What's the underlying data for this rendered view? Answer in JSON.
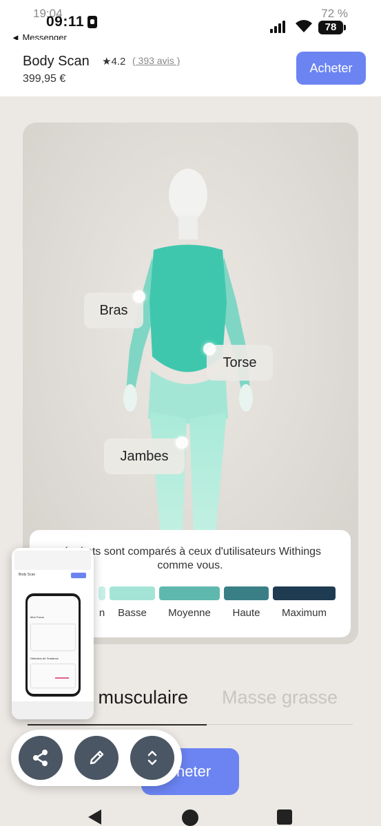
{
  "status_bar": {
    "ghost_time": "19:04",
    "time": "09:11",
    "ghost_battery": "72 %",
    "battery": "78",
    "back_app": "◄ Messenger"
  },
  "product": {
    "name": "Body Scan",
    "rating": "★4.2",
    "reviews": "( 393 avis )",
    "price": "399,95 €",
    "buy_label": "Acheter"
  },
  "body_scan": {
    "labels": {
      "arms": "Bras",
      "torso": "Torse",
      "legs": "Jambes"
    },
    "legend_text": "résultats sont comparés à ceux d'utilisateurs Withings comme vous.",
    "levels": [
      {
        "label": "n",
        "color": "#c7f0e6"
      },
      {
        "label": "Basse",
        "color": "#a3e4d6"
      },
      {
        "label": "Moyenne",
        "color": "#5fb8ad"
      },
      {
        "label": "Haute",
        "color": "#3b7f86"
      },
      {
        "label": "Maximum",
        "color": "#1e3b52"
      }
    ]
  },
  "tabs": {
    "active": "e musculaire",
    "inactive": "Masse grasse"
  },
  "bottom_buy_label": "cheter",
  "preview": {
    "title": "Body Scan",
    "focus": "Mon Focus",
    "trend": "Détection de Tendance"
  },
  "fab": {
    "share": "share-icon",
    "edit": "pencil-icon",
    "expand": "expand-icon"
  }
}
